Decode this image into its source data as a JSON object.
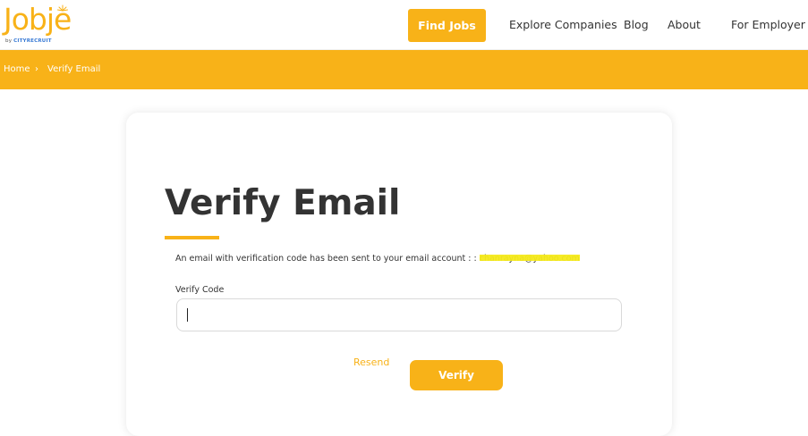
{
  "brand": {
    "logo_text": "Jobje",
    "logo_by": "by ",
    "logo_company": "CITYRECRUIT",
    "accent_color": "#f8b218"
  },
  "nav": {
    "find_jobs": "Find Jobs",
    "explore_companies": "Explore Companies",
    "blog": "Blog",
    "about": "About",
    "for_employer": "For Employer"
  },
  "breadcrumb": {
    "home": "Home",
    "separator": "›",
    "current": "Verify Email"
  },
  "card": {
    "title": "Verify Email",
    "message_prefix": "An email with verification code has been sent to your email account : :",
    "email": "chanrayna@yahoo.com",
    "field_label": "Verify Code",
    "code_value": "",
    "resend_label": "Resend",
    "verify_label": "Verify"
  }
}
